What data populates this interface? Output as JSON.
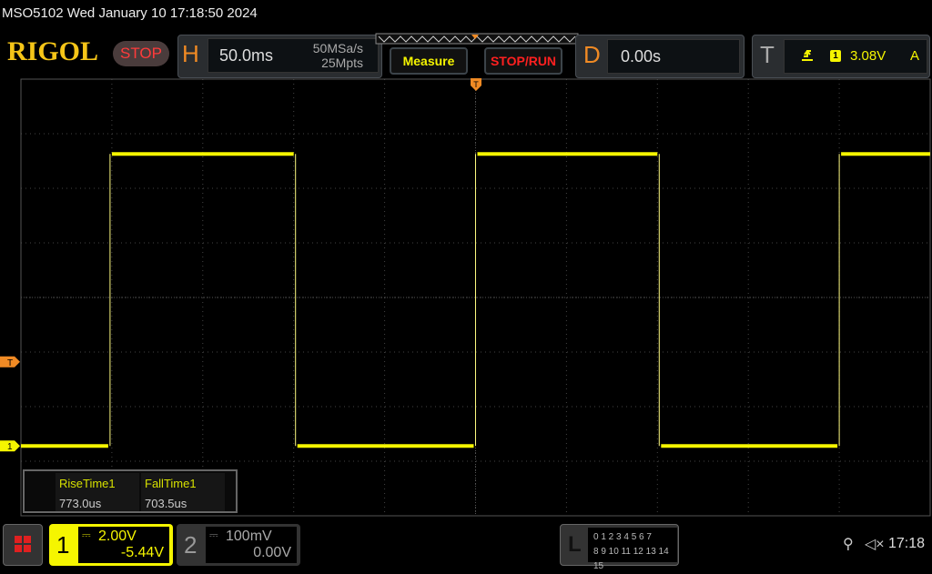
{
  "status_bar": {
    "title": "MSO5102  Wed January 10 17:18:50 2024"
  },
  "header": {
    "logo": "RIGOL",
    "run_state": "STOP",
    "horizontal": {
      "letter": "H",
      "timebase": "50.0ms",
      "sample_rate": "50MSa/s",
      "memory_depth": "25Mpts"
    },
    "measure_label": "Measure",
    "stoprun_label": "STOP/RUN",
    "delay": {
      "letter": "D",
      "value": "0.00s"
    },
    "trigger": {
      "letter": "T",
      "source": "1",
      "level": "3.08V",
      "mode": "A",
      "slope_icon": "rising-edge-icon"
    }
  },
  "markers": {
    "trigger_level": "T",
    "ch1": "1",
    "trigger_position": "T"
  },
  "measurements": [
    {
      "name": "RiseTime1",
      "value": "773.0us"
    },
    {
      "name": "FallTime1",
      "value": "703.5us"
    }
  ],
  "channels": [
    {
      "num": "1",
      "scale": "2.00V",
      "offset": "-5.44V",
      "active": true,
      "color": "#f5f500"
    },
    {
      "num": "2",
      "scale": "100mV",
      "offset": "0.00V",
      "active": false
    }
  ],
  "logic": {
    "letter": "L",
    "row1": "0 1 2 3  4 5 6 7",
    "row2": "8 9 10 11 12 13 14 15"
  },
  "system": {
    "time": "17:18",
    "usb_icon": "usb-icon",
    "sound_icon": "mute-icon"
  },
  "chart_data": {
    "type": "line",
    "time_per_div_ms": 50,
    "volts_per_div": 2,
    "xlim_ms": [
      -250,
      250
    ],
    "ch1_offset_v": -5.44,
    "trigger_level_v": 3.08,
    "low_v": 0,
    "high_v": 10.7,
    "edges_ms": [
      {
        "t": -201,
        "dir": "rise"
      },
      {
        "t": -99,
        "dir": "fall"
      },
      {
        "t": 0,
        "dir": "rise"
      },
      {
        "t": 101,
        "dir": "fall"
      },
      {
        "t": 200,
        "dir": "rise"
      }
    ],
    "initial_level": "low",
    "grid": true
  }
}
